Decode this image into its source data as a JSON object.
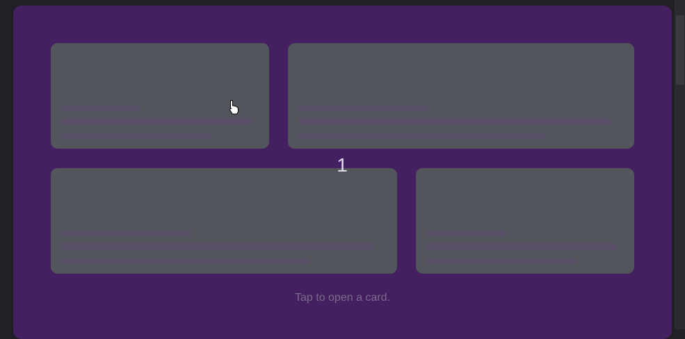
{
  "overlay": {
    "counter": "1",
    "hint": "Tap to open a card."
  },
  "cards": [
    {
      "name": "skeleton-card-1",
      "lines": [
        0.42,
        0.88,
        0.7
      ]
    },
    {
      "name": "skeleton-card-2",
      "lines": [
        0.4,
        0.92,
        0.72
      ]
    },
    {
      "name": "skeleton-card-3",
      "lines": [
        0.38,
        0.91,
        0.72
      ]
    },
    {
      "name": "skeleton-card-4",
      "lines": [
        0.4,
        0.88,
        0.72
      ]
    }
  ],
  "colors": {
    "page_bg": "#202126",
    "panel_bg": "#452061",
    "card_bg": "#53555c",
    "skeleton_line": "#5a5169",
    "counter_text": "#e4d8ee",
    "hint_text": "#7a6a8c"
  }
}
